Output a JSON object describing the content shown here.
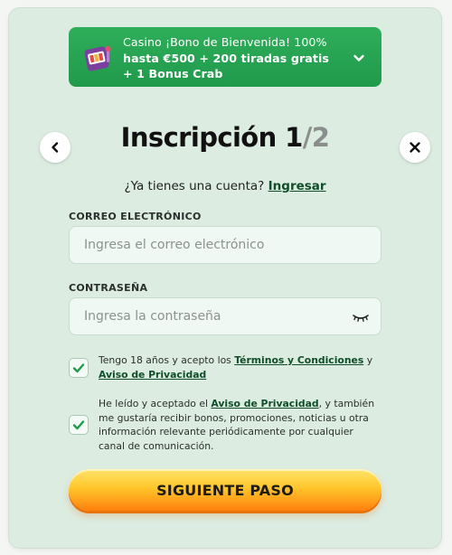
{
  "promo": {
    "line1": "Casino ¡Bono de Bienvenida! 100%",
    "line2": "hasta €500 + 200 tiradas gratis",
    "line3": "+ 1 Bonus Crab"
  },
  "header": {
    "title": "Inscripción 1",
    "step_total": "/2"
  },
  "login": {
    "prompt": "¿Ya tienes una cuenta?",
    "link": "Ingresar"
  },
  "email": {
    "label": "CORREO ELECTRÓNICO",
    "placeholder": "Ingresa el correo electrónico",
    "value": ""
  },
  "password": {
    "label": "CONTRASEÑA",
    "placeholder": "Ingresa la contraseña",
    "value": ""
  },
  "consent1": {
    "checked": true,
    "text_a": "Tengo 18 años y acepto los ",
    "link_terms": "Términos y Condiciones",
    "text_b": " y ",
    "link_privacy": "Aviso de Privacidad"
  },
  "consent2": {
    "checked": true,
    "text_a": "He leído y aceptado el ",
    "link_privacy": "Aviso de Privacidad",
    "text_b": ", y también me gustaría recibir bonos, promociones, noticias u otra información relevante periódicamente por cualquier canal de comunicación."
  },
  "cta": {
    "label": "SIGUIENTE PASO"
  },
  "icons": {
    "promo": "slot-machine-icon",
    "expand": "chevron-down-icon",
    "back": "chevron-left-icon",
    "close": "close-icon",
    "password_toggle": "eye-closed-icon",
    "check": "checkmark-icon"
  },
  "colors": {
    "promo_bg": "#24a350",
    "modal_bg": "#dcece0",
    "link": "#0f4d2b",
    "cta_top": "#ffe56b",
    "cta_bottom": "#ff7f0a"
  }
}
